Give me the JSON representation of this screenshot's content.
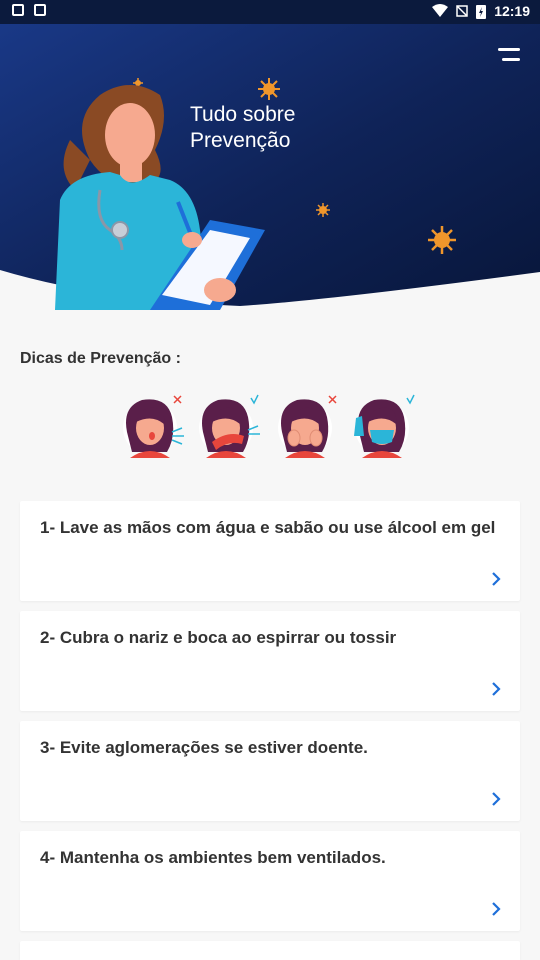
{
  "status_bar": {
    "time": "12:19"
  },
  "header": {
    "title_line1": "Tudo sobre",
    "title_line2": "Prevenção"
  },
  "section": {
    "title": "Dicas de Prevenção :"
  },
  "tips_icons": [
    {
      "name": "cough-without-cover-icon",
      "mark": "wrong"
    },
    {
      "name": "cough-into-elbow-icon",
      "mark": "right"
    },
    {
      "name": "touch-face-icon",
      "mark": "wrong"
    },
    {
      "name": "wear-mask-icon",
      "mark": "right"
    }
  ],
  "cards": [
    {
      "label": "1- Lave as mãos com água e sabão ou use álcool em gel"
    },
    {
      "label": "2- Cubra o nariz e boca ao espirrar ou tossir"
    },
    {
      "label": "3- Evite aglomerações se estiver doente."
    },
    {
      "label": "4- Mantenha os ambientes bem ventilados."
    },
    {
      "label": ""
    }
  ],
  "colors": {
    "header_dark": "#0b1a3d",
    "header_mid": "#13296a",
    "accent_blue": "#1e6fd9",
    "virus_orange": "#f0962b",
    "skin": "#f6a98f",
    "scrub": "#2bb5d8",
    "text_dark": "#333333",
    "wrong_red": "#e8463c",
    "right_teal": "#2bb5d8"
  }
}
